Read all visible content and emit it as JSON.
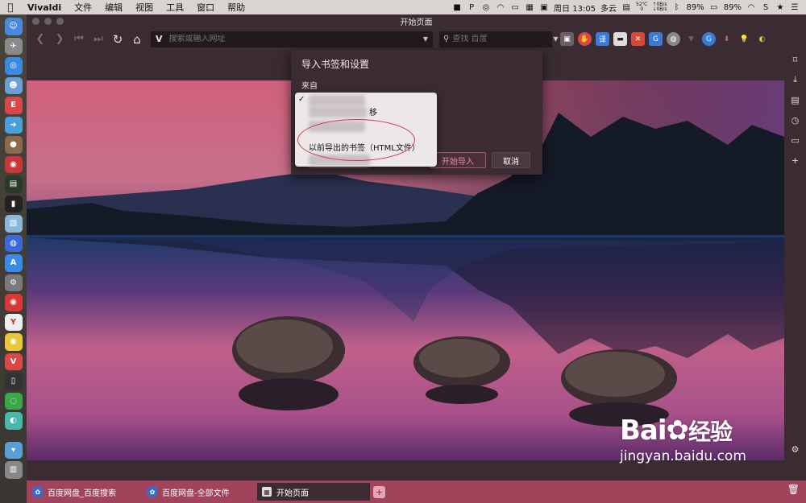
{
  "menubar": {
    "app_name": "Vivaldi",
    "items": [
      "文件",
      "编辑",
      "视图",
      "工具",
      "窗口",
      "帮助"
    ],
    "temp_top": "52℃",
    "temp_bottom": "0",
    "net_up": "↑0B/s",
    "net_down": "↓0B/s",
    "clock": "周日 13:05",
    "weather": "多云",
    "battery_1": "89%",
    "battery_2": "89%"
  },
  "window": {
    "title": "开始页面"
  },
  "toolbar": {
    "address_placeholder": "搜索或输入网址",
    "address_logo": "V",
    "search_placeholder": "查找 百度"
  },
  "dialog": {
    "title": "导入书签和设置",
    "from_label": "来自",
    "start_button": "开始导入",
    "cancel_button": "取消"
  },
  "dropdown": {
    "partial_text": "移",
    "html_option": "以前导出的书签（HTML文件）"
  },
  "tabs": [
    {
      "label": "百度网盘_百度搜索",
      "icon": "paw-icon"
    },
    {
      "label": "百度网盘-全部文件",
      "icon": "paw-icon"
    },
    {
      "label": "开始页面",
      "icon": "grid-icon"
    }
  ],
  "watermark": {
    "brand": "Bai",
    "brand_suffix": "经验",
    "site": "jingyan.baidu.com"
  },
  "colors": {
    "accent": "#a0445c",
    "chrome": "#3a2c32",
    "highlight_circle": "#d23a4a"
  }
}
